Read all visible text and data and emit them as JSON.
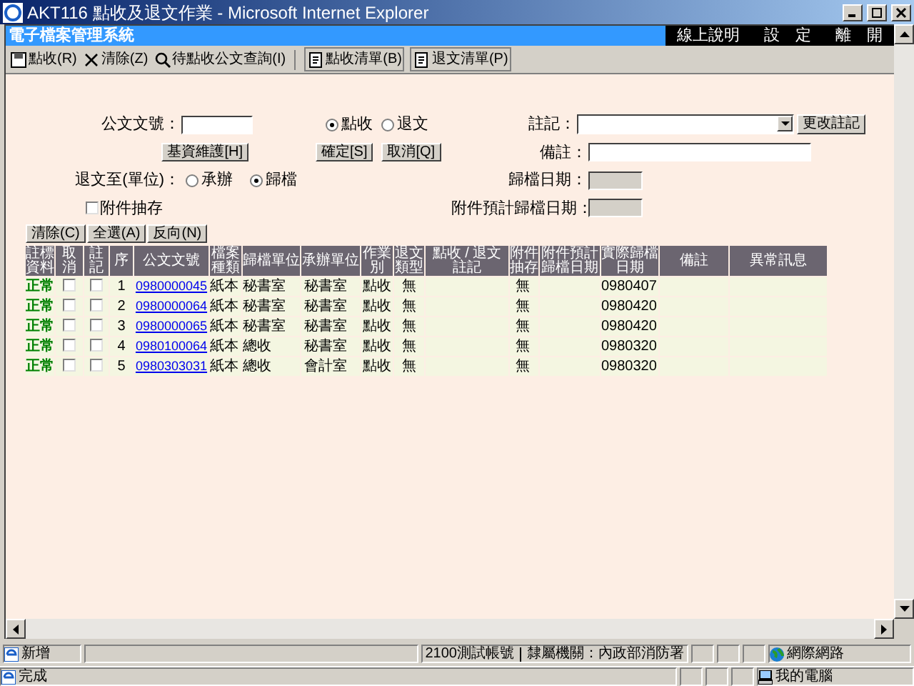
{
  "window": {
    "title": "AKT116 點收及退文作業 - Microsoft Internet Explorer"
  },
  "header": {
    "title": "電子檔案管理系統",
    "menu": [
      "線上說明",
      "設　定",
      "離　開"
    ]
  },
  "toolbar": [
    {
      "label": "點收(R)"
    },
    {
      "label": "清除(Z)"
    },
    {
      "label": "待點收公文查詢(I)"
    },
    {
      "label": "點收清單(B)"
    },
    {
      "label": "退文清單(P)"
    }
  ],
  "form": {
    "doc_no": {
      "label": "公文文號："
    },
    "mode": [
      {
        "label": "點收",
        "selected": true
      },
      {
        "label": "退文",
        "selected": false
      }
    ],
    "note": {
      "label": "註記："
    },
    "change_note_button": "更改註記",
    "basic_button": "基資維護[H]",
    "ok_button": "確定[S]",
    "cancel_button": "取消[Q]",
    "remark": {
      "label": "備註："
    },
    "return_to": {
      "label": "退文至(單位)：",
      "options": [
        {
          "label": "承辦",
          "selected": false
        },
        {
          "label": "歸檔",
          "selected": true
        }
      ]
    },
    "archive_date": {
      "label": "歸檔日期：",
      "disabled": true
    },
    "attachment": {
      "label": "附件抽存",
      "checked": false
    },
    "attachment_date": {
      "label": "附件預計歸檔日期：",
      "disabled": true
    },
    "list_buttons": [
      "清除(C)",
      "全選(A)",
      "反向(N)"
    ]
  },
  "table": {
    "columns": [
      "註標資料",
      "取消",
      "註記",
      "序",
      "公文文號",
      "檔案種類",
      "歸檔單位",
      "承辦單位",
      "作業別",
      "退文類型",
      "點收 / 退文註記",
      "附件抽存",
      "附件預計歸檔日期",
      "實際歸檔日期",
      "備註",
      "異常訊息"
    ],
    "rows": [
      {
        "status": "正常",
        "cancel": false,
        "mark": false,
        "no": "1",
        "doc_no": "0980000045",
        "type": "紙本",
        "archive_unit": "秘書室",
        "handler": "秘書室",
        "op": "點收",
        "return_type": "無",
        "attach": "無",
        "date": "0980407"
      },
      {
        "status": "正常",
        "cancel": false,
        "mark": false,
        "no": "2",
        "doc_no": "0980000064",
        "type": "紙本",
        "archive_unit": "秘書室",
        "handler": "秘書室",
        "op": "點收",
        "return_type": "無",
        "attach": "無",
        "date": "0980420"
      },
      {
        "status": "正常",
        "cancel": false,
        "mark": false,
        "no": "3",
        "doc_no": "0980000065",
        "type": "紙本",
        "archive_unit": "秘書室",
        "handler": "秘書室",
        "op": "點收",
        "return_type": "無",
        "attach": "無",
        "date": "0980420"
      },
      {
        "status": "正常",
        "cancel": false,
        "mark": false,
        "no": "4",
        "doc_no": "0980100064",
        "type": "紙本",
        "archive_unit": "總收",
        "handler": "秘書室",
        "op": "點收",
        "return_type": "無",
        "attach": "無",
        "date": "0980320"
      },
      {
        "status": "正常",
        "cancel": false,
        "mark": false,
        "no": "5",
        "doc_no": "0980303031",
        "type": "紙本",
        "archive_unit": "總收",
        "handler": "會計室",
        "op": "點收",
        "return_type": "無",
        "attach": "無",
        "date": "0980320"
      }
    ]
  },
  "status_bar": {
    "left": "新增",
    "user": "2100測試帳號",
    "agency": "隸屬機關：內政部消防署",
    "zone": "網際網路"
  },
  "ie_status": {
    "left": "完成",
    "zone": "我的電腦"
  }
}
